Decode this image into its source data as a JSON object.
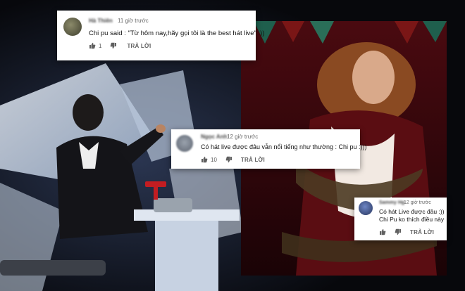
{
  "comments": [
    {
      "author": "Hà Thiên",
      "time": "11 giờ trước",
      "text": "Chi pu said : \"Từ hôm nay,hãy gọi tôi là the best hát live\" :))",
      "likes": "1",
      "reply_label": "TRẢ LỜI"
    },
    {
      "author": "Ngọc Anh",
      "time": "12 giờ trước",
      "text": "Có hát live được đâu vẫn nổi tiếng như thường : Chi pu :)))",
      "likes": "10",
      "reply_label": "TRẢ LỜI"
    },
    {
      "author": "Sammy Hg",
      "time": "12 giờ trước",
      "text_lines": [
        "Có hát Live được đâu :))",
        "Chi Pu ko thích điều này"
      ],
      "likes": "",
      "reply_label": "TRẢ LỜI"
    }
  ],
  "icons": [
    "thumbs-up-icon",
    "thumbs-down-icon"
  ],
  "colors": {
    "card_bg": "#ffffff",
    "muted_text": "#606060",
    "stage_blue": "#1b2740",
    "curtain_red": "#8a1a1e"
  }
}
